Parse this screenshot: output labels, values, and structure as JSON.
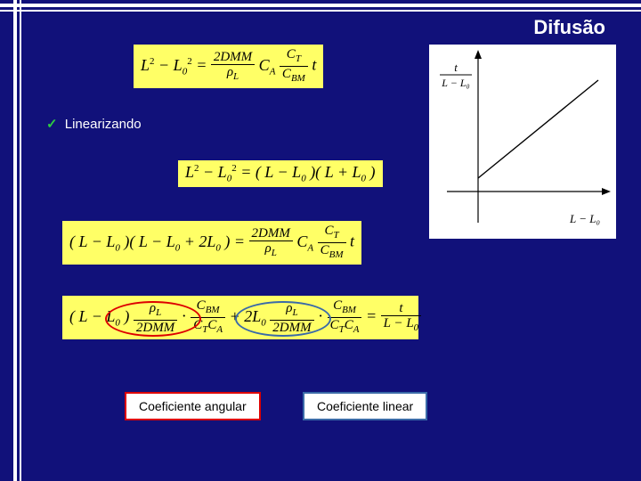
{
  "title": "Difusão",
  "bullet": {
    "checkmark": "✓",
    "text": "Linearizando"
  },
  "equations": {
    "eq1": {
      "lhs": "L² − L₀² =",
      "frac1": {
        "num": "2DMM",
        "den": "ρ_L"
      },
      "mid": " C_A ",
      "frac2": {
        "num": "C_T",
        "den": "C_BM"
      },
      "tail": " t"
    },
    "eq2": "L² − L₀² = ( L − L₀ )( L + L₀ )",
    "eq3": {
      "lhs": "( L − L₀ )( L − L₀ + 2L₀ ) = ",
      "frac1": {
        "num": "2DMM",
        "den": "ρ_L"
      },
      "mid": " C_A ",
      "frac2": {
        "num": "C_T",
        "den": "C_BM"
      },
      "tail": " t"
    },
    "eq4": {
      "lhs": "( L − L₀ ) ",
      "frac1": {
        "num": "ρ_L",
        "den": "2DMM"
      },
      "frac2": {
        "num": "C_BM",
        "den": "C_T C_A"
      },
      "plus": " + 2L₀ ",
      "frac3": {
        "num": "ρ_L",
        "den": "2DMM"
      },
      "frac4": {
        "num": "C_BM",
        "den": "C_T C_A"
      },
      "eq": " = ",
      "frac5": {
        "num": "t",
        "den": "L − L₀"
      }
    }
  },
  "graph": {
    "y_label": {
      "num": "t",
      "den": "L − L₀"
    },
    "x_label": "L − L₀"
  },
  "labels": {
    "coef_angular": "Coeficiente angular",
    "coef_linear": "Coeficiente linear"
  }
}
